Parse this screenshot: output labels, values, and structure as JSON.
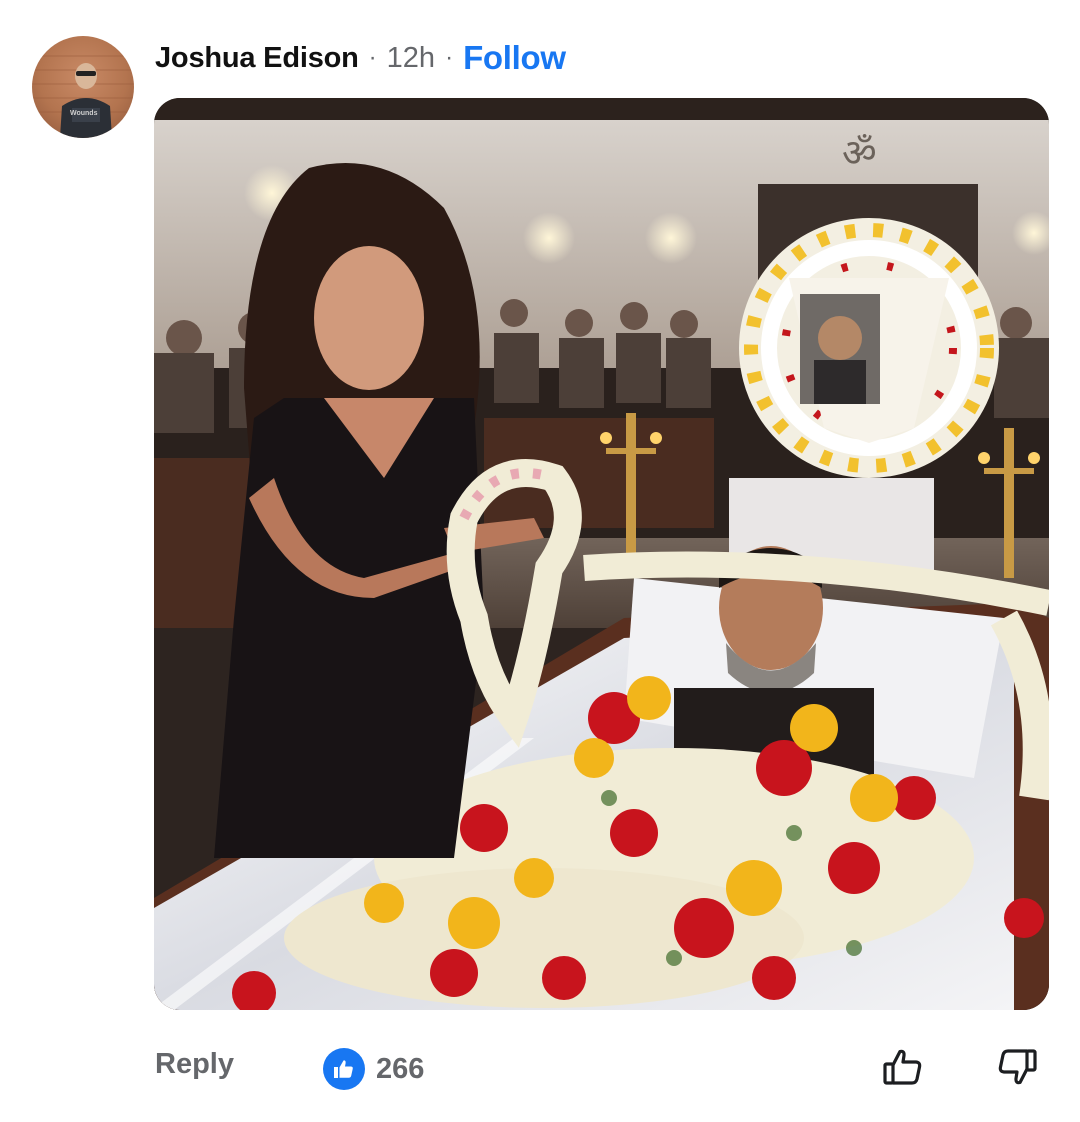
{
  "comment": {
    "author": "Joshua Edison",
    "separator": "·",
    "time": "12h",
    "follow_label": "Follow",
    "avatar_text": "Wounds",
    "media_icon": "funeral-photo",
    "reply_label": "Reply",
    "reaction_icon": "like-reaction-icon",
    "like_count": "266",
    "upvote_icon": "thumb-up-icon",
    "downvote_icon": "thumb-down-icon"
  },
  "colors": {
    "accent": "#1877f2",
    "secondary_text": "#65676b",
    "primary_text": "#111111"
  }
}
